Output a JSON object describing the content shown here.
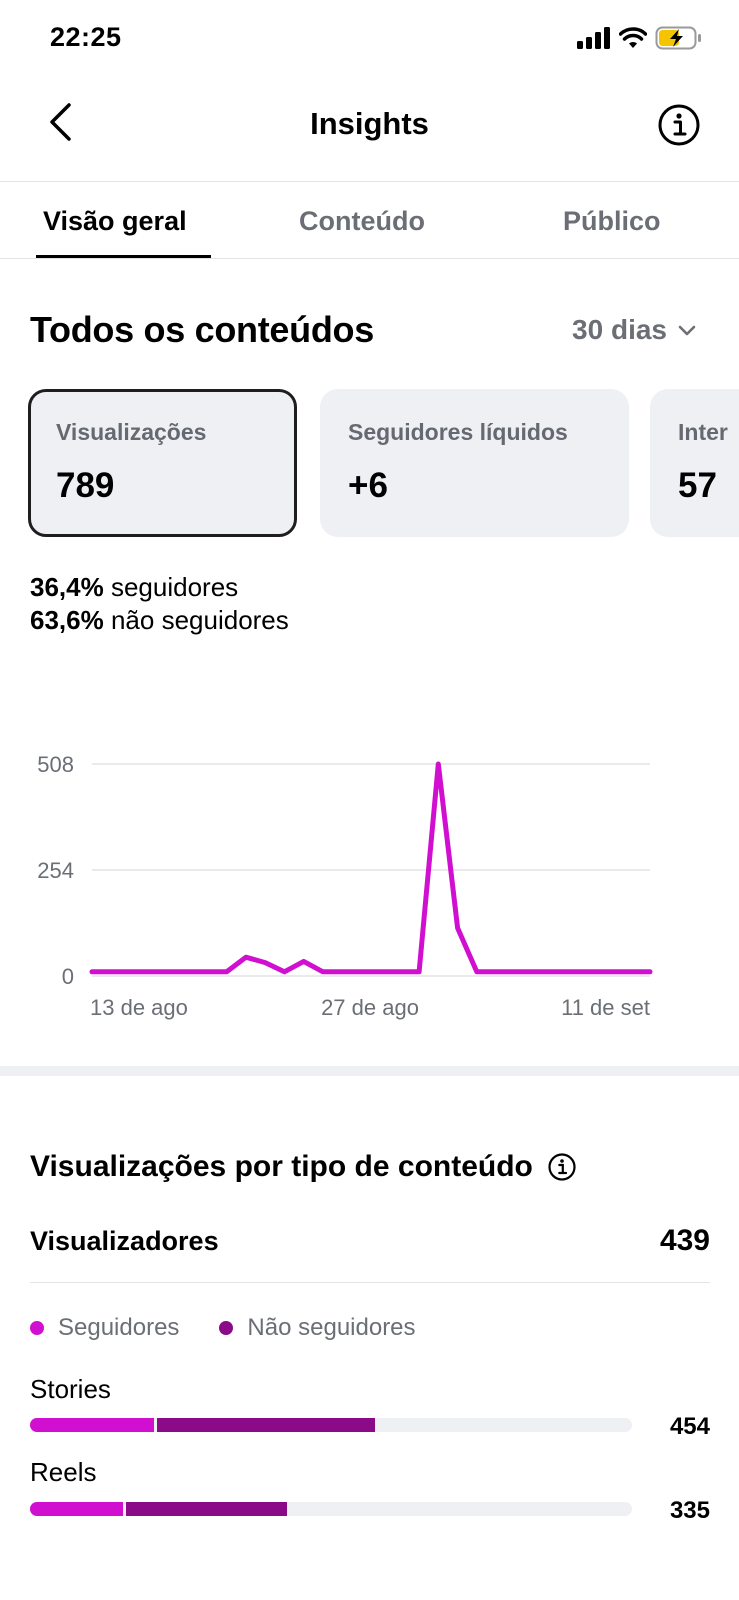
{
  "status_bar": {
    "time": "22:25"
  },
  "header": {
    "title": "Insights"
  },
  "tabs": [
    {
      "label": "Visão geral",
      "active": true
    },
    {
      "label": "Conteúdo",
      "active": false
    },
    {
      "label": "Público",
      "active": false
    }
  ],
  "overview": {
    "title": "Todos os conteúdos",
    "period": "30 dias",
    "cards": [
      {
        "label": "Visualizações",
        "value": "789",
        "selected": true
      },
      {
        "label": "Seguidores líquidos",
        "value": "+6",
        "selected": false
      },
      {
        "label": "Inter",
        "value": "57",
        "selected": false
      }
    ],
    "followers_pct": "36,4%",
    "followers_text": "seguidores",
    "nonfollowers_pct": "63,6%",
    "nonfollowers_text": "não seguidores"
  },
  "chart_data": {
    "type": "line",
    "ytick_labels": [
      "508",
      "254",
      "0"
    ],
    "yticks": [
      508,
      254,
      0
    ],
    "ylim": [
      0,
      508
    ],
    "xtick_labels": [
      "13 de ago",
      "27 de ago",
      "11 de set"
    ],
    "grid": true,
    "color": "#d10fd0",
    "values": [
      10,
      10,
      10,
      10,
      10,
      10,
      10,
      10,
      45,
      32,
      10,
      35,
      10,
      10,
      10,
      10,
      10,
      10,
      508,
      115,
      10,
      10,
      10,
      10,
      10,
      10,
      10,
      10,
      10,
      10
    ]
  },
  "content_views": {
    "title": "Visualizações por tipo de conteúdo",
    "viewers_label": "Visualizadores",
    "viewers_value": "439",
    "legend": [
      {
        "label": "Seguidores",
        "color": "#d10fd0"
      },
      {
        "label": "Não seguidores",
        "color": "#8a0a87"
      }
    ],
    "bars": [
      {
        "label": "Stories",
        "value": "454",
        "followers_fraction": 0.206,
        "nonfollowers_fraction": 0.367
      },
      {
        "label": "Reels",
        "value": "335",
        "followers_fraction": 0.155,
        "nonfollowers_fraction": 0.272
      }
    ]
  }
}
